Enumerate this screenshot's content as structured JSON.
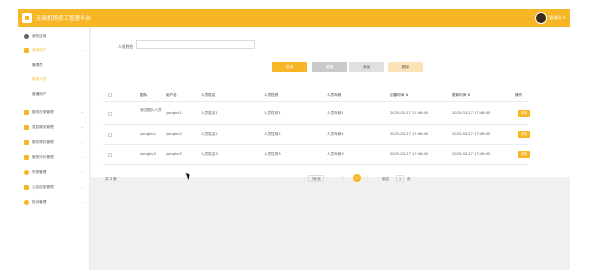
{
  "header": {
    "title": "无锡机场员工管理平台",
    "user": "管理员 ▾"
  },
  "sidebar": {
    "items": [
      {
        "label": "我的应用"
      },
      {
        "label": "系统用户",
        "chevron": "⌄"
      },
      {
        "label": "服务日常管理",
        "chevron": "⌄"
      },
      {
        "label": "发起服务管理",
        "chevron": "⌄"
      },
      {
        "label": "服务预约管理",
        "chevron": "⌄"
      },
      {
        "label": "服务评价管理",
        "chevron": "⌄"
      },
      {
        "label": "失物管理",
        "chevron": "⌄"
      },
      {
        "label": "公告信息管理",
        "chevron": "⌄"
      },
      {
        "label": "投诉管理",
        "chevron": "⌄"
      }
    ],
    "subitems": [
      {
        "label": "管理员"
      },
      {
        "label": "服务人员"
      },
      {
        "label": "普通用户"
      }
    ]
  },
  "filter": {
    "label": "人员姓名",
    "value": ""
  },
  "buttons": {
    "search": "查询",
    "reset": "重置",
    "add": "添加",
    "delete": "删除"
  },
  "table": {
    "headers": [
      "图标",
      "用户名",
      "人员姓名",
      "人员性别",
      "人员年龄",
      "创建时间 ⇅",
      "更新时间 ⇅",
      "操作"
    ],
    "rows": [
      [
        "测试图片人员",
        "yonghu1",
        "人员姓名1",
        "人员性别1",
        "人员年龄1",
        "2025-03-27 17:46:45",
        "2025-03-27 17:46:45",
        "详情"
      ],
      [
        "yonghu2",
        "yonghu2",
        "人员姓名2",
        "人员性别2",
        "人员年龄2",
        "2025-03-27 17:46:45",
        "2025-03-27 17:46:45",
        "详情"
      ],
      [
        "yonghu3",
        "yonghu3",
        "人员姓名3",
        "人员性别3",
        "人员年龄3",
        "2025-03-27 17:46:45",
        "2025-03-27 17:46:45",
        "详情"
      ]
    ]
  },
  "pagination": {
    "total": "共 3 条",
    "page_size": "7条/页",
    "prev": "‹",
    "current": "1",
    "next": "›",
    "goto_label": "前往",
    "goto_value": "1",
    "page_suffix": "页"
  },
  "colors": {
    "accent": "#f6b625",
    "reset": "#c9c9c9",
    "add": "#e0e0e0",
    "delete": "#fbe3b8"
  }
}
